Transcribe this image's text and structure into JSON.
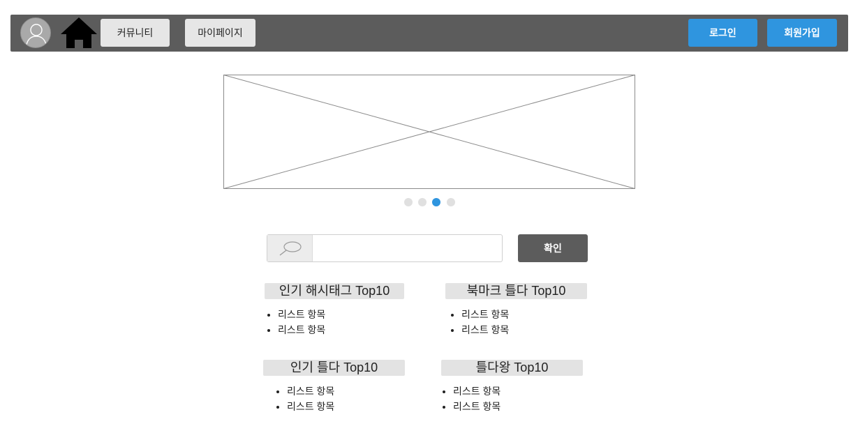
{
  "header": {
    "avatar_icon": "user-avatar-icon",
    "home_icon": "home-icon",
    "nav": {
      "community": "커뮤니티",
      "mypage": "마이페이지"
    },
    "auth": {
      "login": "로그인",
      "signup": "회원가입"
    },
    "colors": {
      "bar": "#5c5c5c",
      "auth_button": "#2f95df"
    }
  },
  "carousel": {
    "image_icon": "image-placeholder",
    "dots": [
      {
        "active": false
      },
      {
        "active": false
      },
      {
        "active": true
      },
      {
        "active": false
      }
    ],
    "active_color": "#2f95df",
    "inactive_color": "#e0e0e0"
  },
  "search": {
    "icon": "search-icon",
    "value": "",
    "placeholder": "",
    "confirm_label": "확인"
  },
  "sections": [
    {
      "title": "인기 해시태그 Top10",
      "items": [
        "리스트 항목",
        "리스트 항목"
      ]
    },
    {
      "title": "북마크 틀다 Top10",
      "items": [
        "리스트 항목",
        "리스트 항목"
      ]
    },
    {
      "title": "인기 틀다 Top10",
      "items": [
        "리스트 항목",
        "리스트 항목"
      ]
    },
    {
      "title": "틀다왕 Top10",
      "items": [
        "리스트 항목",
        "리스트 항목"
      ]
    }
  ]
}
